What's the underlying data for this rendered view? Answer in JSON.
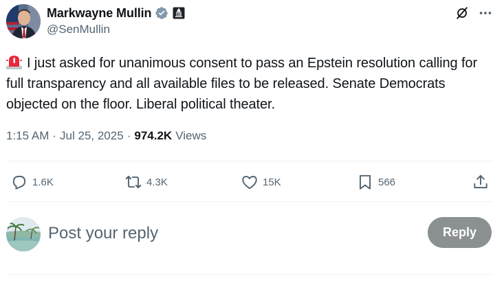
{
  "author": {
    "display_name": "Markwayne Mullin",
    "handle": "@SenMullin",
    "avatar_icon": "senator-portrait-avatar",
    "verified_icon": "verified-badge-gray-icon",
    "affiliation_icon": "us-capitol-gov-badge-icon"
  },
  "header_icons": [
    "grok-icon",
    "more-options-icon"
  ],
  "tweet": {
    "emoji_icon": "police-siren-emoji-icon",
    "text": "I just asked for unanimous consent to pass an Epstein resolution calling for full transparency and all available files to be released. Senate Democrats objected on the floor. Liberal political theater."
  },
  "meta": {
    "time": "1:15 AM",
    "separator": "·",
    "date": "Jul 25, 2025",
    "separator2": "·",
    "views_count": "974.2K",
    "views_label": "Views"
  },
  "actions": {
    "replies": "1.6K",
    "reposts": "4.3K",
    "likes": "15K",
    "bookmarks": "566"
  },
  "composer": {
    "placeholder": "Post your reply",
    "button_label": "Reply",
    "avatar_icon": "beach-landscape-avatar"
  },
  "colors": {
    "text_primary": "#0f1419",
    "text_secondary": "#536471",
    "divider": "#eff3f4",
    "reply_button_disabled": "#8b9092",
    "verified_gray": "#829aab"
  }
}
